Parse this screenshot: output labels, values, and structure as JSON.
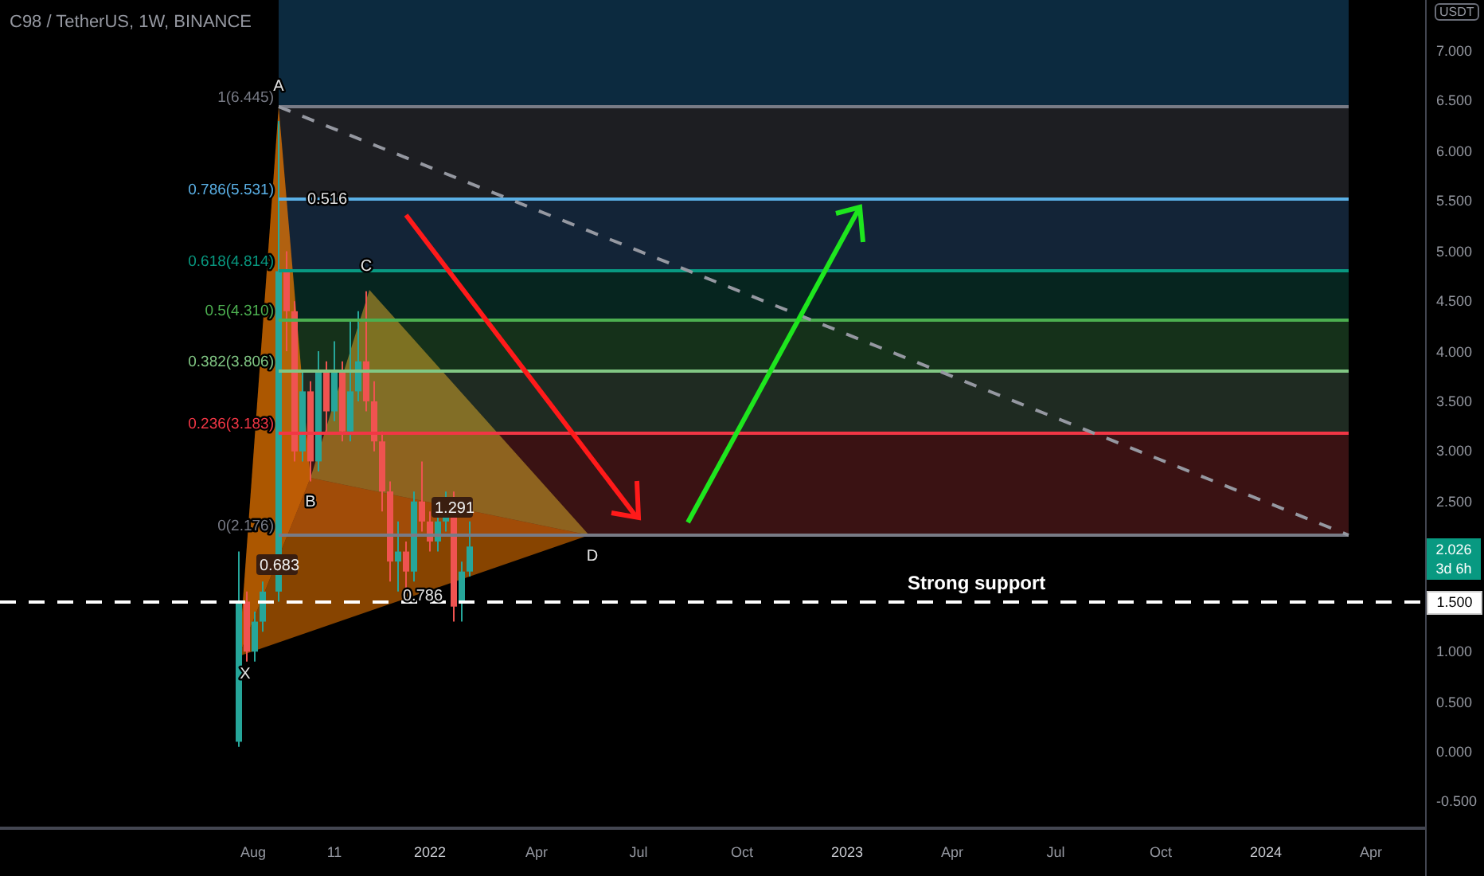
{
  "header": {
    "title": "C98 / TetherUS, 1W, BINANCE"
  },
  "chart": {
    "fib_levels": [
      {
        "label": "1(6.445)",
        "color": "#787b86"
      },
      {
        "label": "0.786(5.531)",
        "color": "#5ab0e6"
      },
      {
        "label": "0.618(4.814)",
        "color": "#089981"
      },
      {
        "label": "0.5(4.310)",
        "color": "#4caf50"
      },
      {
        "label": "0.382(3.806)",
        "color": "#81c784"
      },
      {
        "label": "0.236(3.183)",
        "color": "#f23645"
      },
      {
        "label": "0(2.176)",
        "color": "#787b86"
      }
    ],
    "points": [
      {
        "label": "A"
      },
      {
        "label": "B"
      },
      {
        "label": "C"
      },
      {
        "label": "D"
      },
      {
        "label": "X"
      }
    ],
    "ratios": [
      {
        "label": "0.516",
        "kind": "plain"
      },
      {
        "label": "0.683",
        "kind": "boxed"
      },
      {
        "label": "1.291",
        "kind": "boxed"
      },
      {
        "label": "0.786",
        "kind": "plain"
      }
    ],
    "annotation": "Strong support"
  },
  "price_axis": {
    "currency": "USDT",
    "ticks": [
      "7.000",
      "6.500",
      "6.000",
      "5.500",
      "5.000",
      "4.500",
      "4.000",
      "3.500",
      "3.000",
      "2.500",
      "1.000",
      "0.500",
      "0.000",
      "-0.500"
    ],
    "last_price": {
      "value": "2.026",
      "countdown": "3d 6h"
    },
    "marker": "1.500"
  },
  "time_axis": {
    "ticks": [
      "Aug",
      "11",
      "2022",
      "Apr",
      "Jul",
      "Oct",
      "2023",
      "Apr",
      "Jul",
      "Oct",
      "2024",
      "Apr"
    ]
  }
}
